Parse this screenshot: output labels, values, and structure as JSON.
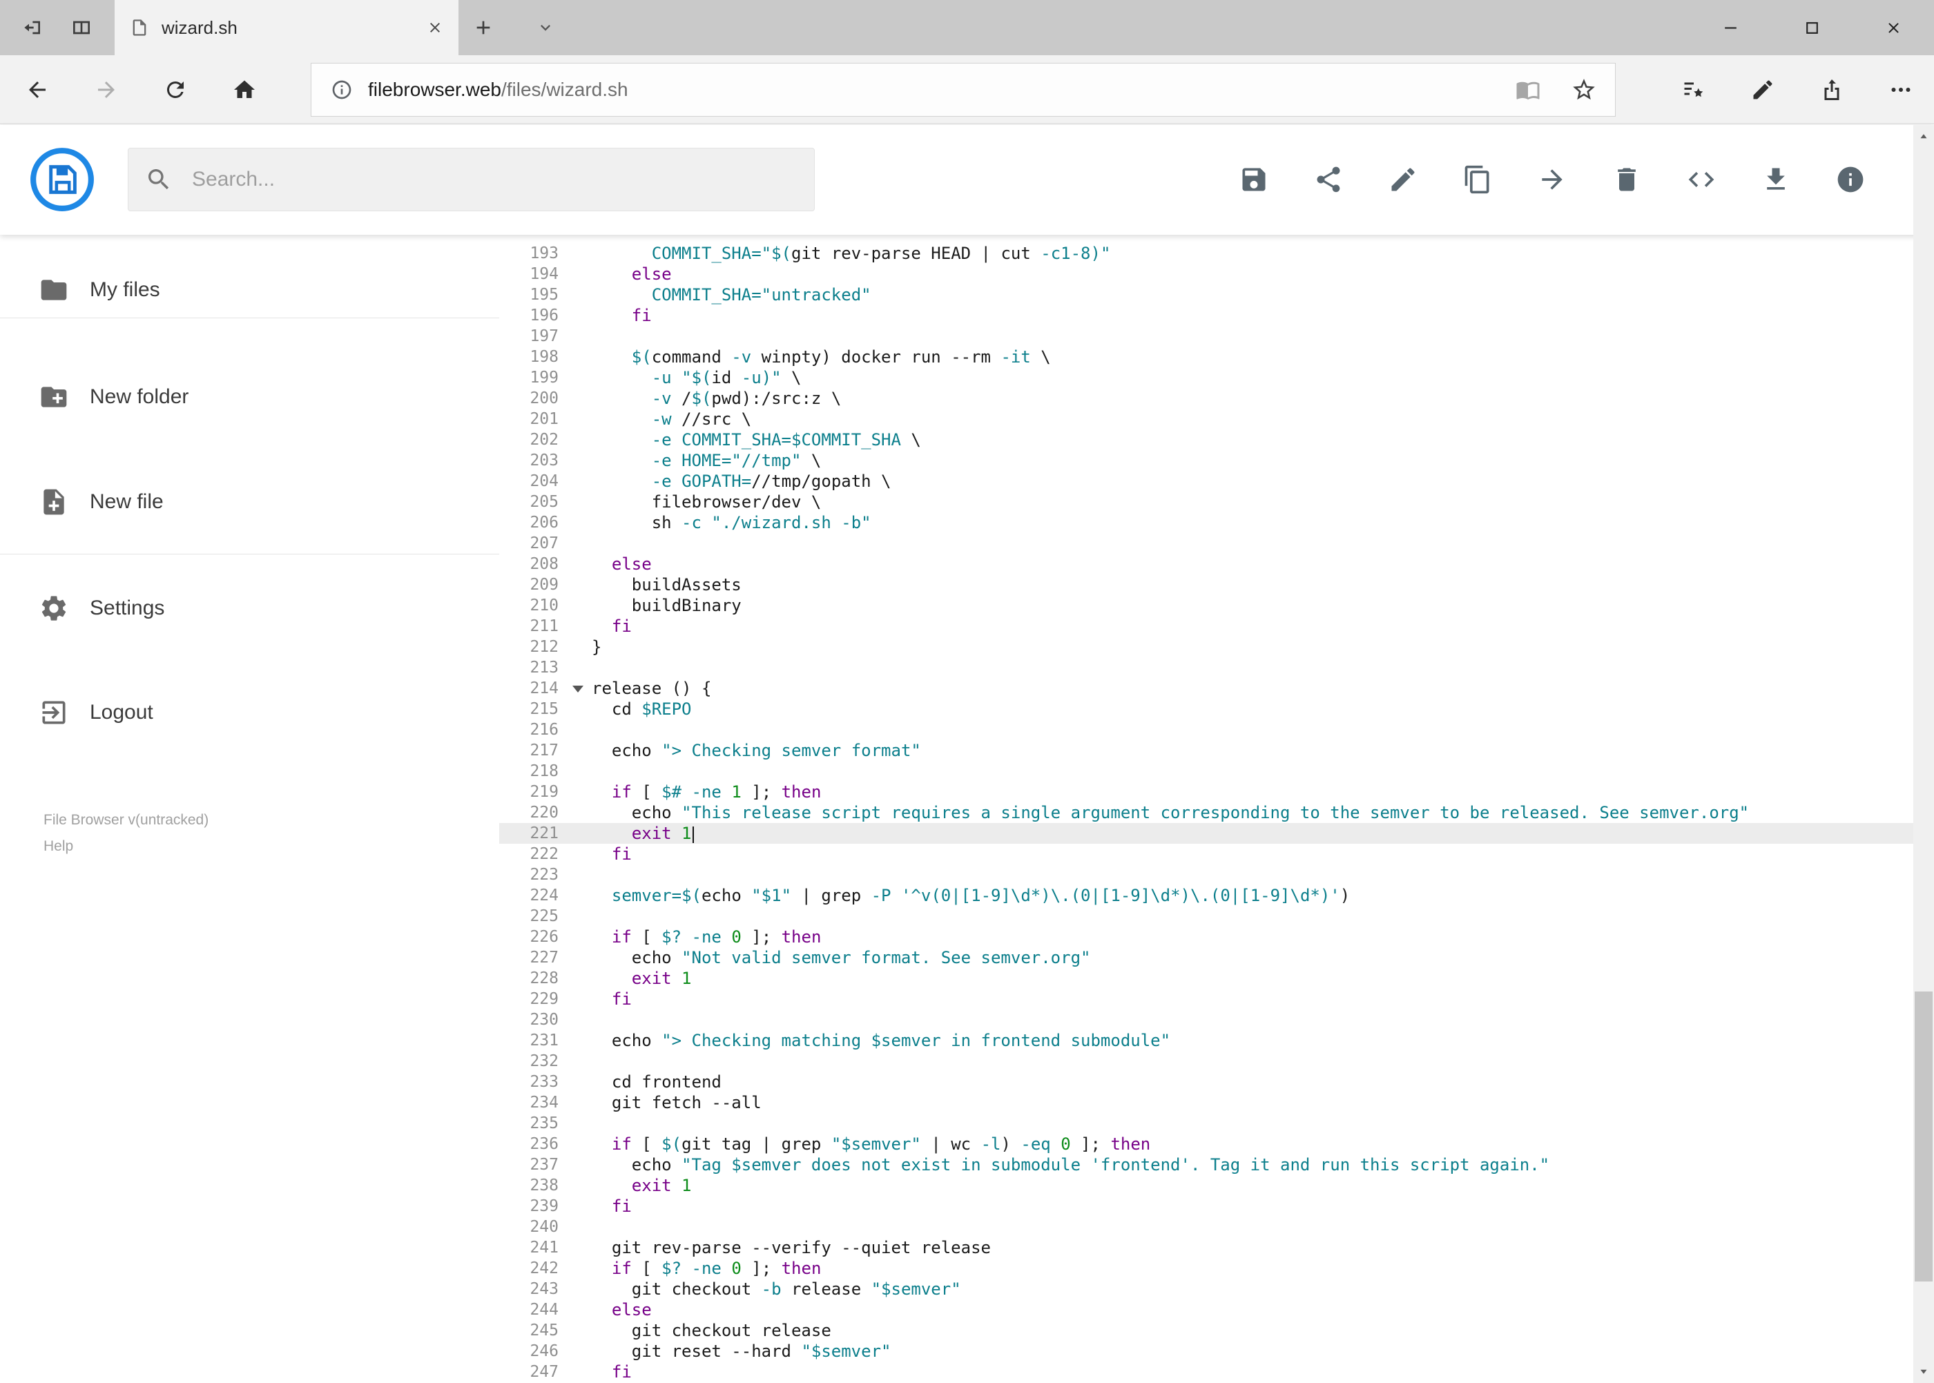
{
  "browser": {
    "tab_strip": {
      "left_buttons": [
        {
          "name": "set-tabs-aside",
          "icon": "set-aside-icon"
        },
        {
          "name": "tab-previews",
          "icon": "panes-icon"
        }
      ],
      "tab": {
        "title": "wizard.sh",
        "favicon": "page-icon",
        "close_icon": "close-icon"
      },
      "new_tab_icon": "plus-icon",
      "preview_toggle_icon": "chevron-down-icon",
      "window_buttons": [
        {
          "name": "minimize",
          "icon": "minimize-icon"
        },
        {
          "name": "maximize",
          "icon": "maximize-icon"
        },
        {
          "name": "close",
          "icon": "close-icon"
        }
      ]
    },
    "nav": {
      "buttons": [
        {
          "name": "back",
          "icon": "arrow-back-icon",
          "enabled": true
        },
        {
          "name": "forward",
          "icon": "arrow-forward-icon",
          "enabled": false
        },
        {
          "name": "refresh",
          "icon": "refresh-icon",
          "enabled": true
        },
        {
          "name": "home",
          "icon": "home-icon",
          "enabled": true
        }
      ],
      "address": {
        "host": "filebrowser.web",
        "path": "/files/wizard.sh",
        "info_icon": "info-outline-icon",
        "reading_view_icon": "book-icon",
        "favorite_icon": "star-outline-icon"
      },
      "right_buttons": [
        {
          "name": "favorites-hub",
          "icon": "hub-icon"
        },
        {
          "name": "web-note",
          "icon": "pen-icon"
        },
        {
          "name": "share-page",
          "icon": "share-arrow-icon"
        },
        {
          "name": "more-options",
          "icon": "ellipsis-icon"
        }
      ]
    }
  },
  "app": {
    "header": {
      "logo_icon": "filebrowser-logo-icon",
      "search": {
        "placeholder": "Search...",
        "icon": "search-icon"
      },
      "toolbar": [
        {
          "name": "save",
          "icon": "save-icon"
        },
        {
          "name": "share",
          "icon": "share-icon"
        },
        {
          "name": "rename",
          "icon": "pencil-icon"
        },
        {
          "name": "copy",
          "icon": "copy-icon"
        },
        {
          "name": "move",
          "icon": "move-icon"
        },
        {
          "name": "delete",
          "icon": "trash-icon"
        },
        {
          "name": "raw-view",
          "icon": "code-icon"
        },
        {
          "name": "download",
          "icon": "download-icon"
        },
        {
          "name": "info",
          "icon": "info-icon"
        }
      ]
    },
    "sidebar": {
      "items": [
        {
          "label": "My files",
          "icon": "folder-icon",
          "divider_after": true
        },
        {
          "label": "New folder",
          "icon": "new-folder-icon"
        },
        {
          "label": "New file",
          "icon": "new-file-icon",
          "divider_after": true
        },
        {
          "label": "Settings",
          "icon": "gear-icon"
        },
        {
          "label": "Logout",
          "icon": "logout-icon"
        }
      ],
      "footer": {
        "version": "File Browser v(untracked)",
        "help": "Help"
      }
    },
    "editor": {
      "active_line": 221,
      "cursor_line": 221,
      "fold_lines": [
        214
      ],
      "lines": [
        {
          "n": 193,
          "t": "      COMMIT_SHA=\"$(git rev-parse HEAD | cut -c1-8)\""
        },
        {
          "n": 194,
          "t": "    else"
        },
        {
          "n": 195,
          "t": "      COMMIT_SHA=\"untracked\""
        },
        {
          "n": 196,
          "t": "    fi"
        },
        {
          "n": 197,
          "t": ""
        },
        {
          "n": 198,
          "t": "    $(command -v winpty) docker run --rm -it \\"
        },
        {
          "n": 199,
          "t": "      -u \"$(id -u)\" \\"
        },
        {
          "n": 200,
          "t": "      -v /$(pwd):/src:z \\"
        },
        {
          "n": 201,
          "t": "      -w //src \\"
        },
        {
          "n": 202,
          "t": "      -e COMMIT_SHA=$COMMIT_SHA \\"
        },
        {
          "n": 203,
          "t": "      -e HOME=\"//tmp\" \\"
        },
        {
          "n": 204,
          "t": "      -e GOPATH=//tmp/gopath \\"
        },
        {
          "n": 205,
          "t": "      filebrowser/dev \\"
        },
        {
          "n": 206,
          "t": "      sh -c \"./wizard.sh -b\""
        },
        {
          "n": 207,
          "t": ""
        },
        {
          "n": 208,
          "t": "  else"
        },
        {
          "n": 209,
          "t": "    buildAssets"
        },
        {
          "n": 210,
          "t": "    buildBinary"
        },
        {
          "n": 211,
          "t": "  fi"
        },
        {
          "n": 212,
          "t": "}"
        },
        {
          "n": 213,
          "t": ""
        },
        {
          "n": 214,
          "t": "release () {"
        },
        {
          "n": 215,
          "t": "  cd $REPO"
        },
        {
          "n": 216,
          "t": ""
        },
        {
          "n": 217,
          "t": "  echo \"> Checking semver format\""
        },
        {
          "n": 218,
          "t": ""
        },
        {
          "n": 219,
          "t": "  if [ $# -ne 1 ]; then"
        },
        {
          "n": 220,
          "t": "    echo \"This release script requires a single argument corresponding to the semver to be released. See semver.org\""
        },
        {
          "n": 221,
          "t": "    exit 1"
        },
        {
          "n": 222,
          "t": "  fi"
        },
        {
          "n": 223,
          "t": ""
        },
        {
          "n": 224,
          "t": "  semver=$(echo \"$1\" | grep -P '^v(0|[1-9]\\d*)\\.(0|[1-9]\\d*)\\.(0|[1-9]\\d*)')"
        },
        {
          "n": 225,
          "t": ""
        },
        {
          "n": 226,
          "t": "  if [ $? -ne 0 ]; then"
        },
        {
          "n": 227,
          "t": "    echo \"Not valid semver format. See semver.org\""
        },
        {
          "n": 228,
          "t": "    exit 1"
        },
        {
          "n": 229,
          "t": "  fi"
        },
        {
          "n": 230,
          "t": ""
        },
        {
          "n": 231,
          "t": "  echo \"> Checking matching $semver in frontend submodule\""
        },
        {
          "n": 232,
          "t": ""
        },
        {
          "n": 233,
          "t": "  cd frontend"
        },
        {
          "n": 234,
          "t": "  git fetch --all"
        },
        {
          "n": 235,
          "t": ""
        },
        {
          "n": 236,
          "t": "  if [ $(git tag | grep \"$semver\" | wc -l) -eq 0 ]; then"
        },
        {
          "n": 237,
          "t": "    echo \"Tag $semver does not exist in submodule 'frontend'. Tag it and run this script again.\""
        },
        {
          "n": 238,
          "t": "    exit 1"
        },
        {
          "n": 239,
          "t": "  fi"
        },
        {
          "n": 240,
          "t": ""
        },
        {
          "n": 241,
          "t": "  git rev-parse --verify --quiet release"
        },
        {
          "n": 242,
          "t": "  if [ $? -ne 0 ]; then"
        },
        {
          "n": 243,
          "t": "    git checkout -b release \"$semver\""
        },
        {
          "n": 244,
          "t": "  else"
        },
        {
          "n": 245,
          "t": "    git checkout release"
        },
        {
          "n": 246,
          "t": "    git reset --hard \"$semver\""
        },
        {
          "n": 247,
          "t": "  fi"
        }
      ]
    }
  },
  "colors": {
    "accent": "#1e88e5",
    "keyword": "#770088",
    "string": "#0c7f8c",
    "variable": "#0c7f8c",
    "number": "#0d8c1a",
    "active_line_bg": "#ececec"
  }
}
